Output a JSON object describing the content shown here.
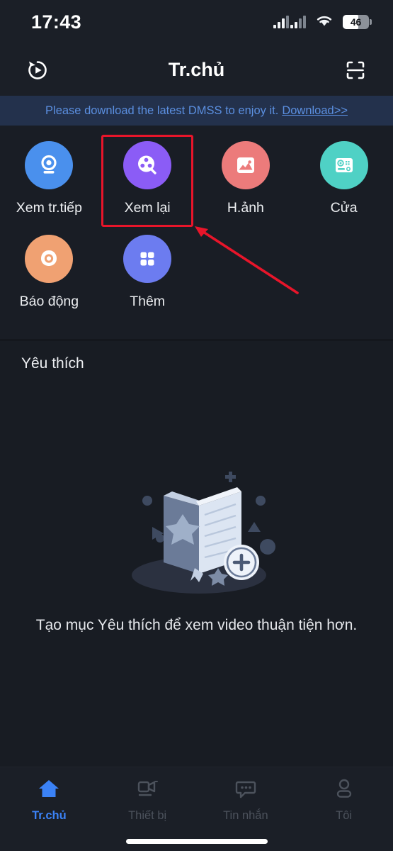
{
  "status_bar": {
    "time": "17:43",
    "signal_icon": "signal-bars-icon",
    "wifi_icon": "wifi-icon",
    "battery_level": "46"
  },
  "header": {
    "title": "Tr.chủ",
    "left_icon": "replay-history-icon",
    "right_icon": "scan-qr-icon"
  },
  "banner": {
    "message": "Please download the latest DMSS to enjoy it.",
    "link_label": "Download>>",
    "text_color": "#5b8fe0",
    "background": "#23314c"
  },
  "shortcuts": [
    {
      "label": "Xem tr.tiếp",
      "icon": "live-camera-icon",
      "color": "#4a90ed"
    },
    {
      "label": "Xem lại",
      "icon": "film-reel-icon",
      "color": "#8b5cf6"
    },
    {
      "label": "H.ảnh",
      "icon": "photo-image-icon",
      "color": "#ec7b7b"
    },
    {
      "label": "Cửa",
      "icon": "door-station-icon",
      "color": "#4fd1c5"
    },
    {
      "label": "Báo động",
      "icon": "alarm-siren-icon",
      "color": "#f0a172"
    },
    {
      "label": "Thêm",
      "icon": "more-grid-icon",
      "color": "#6c7cf0"
    }
  ],
  "favorites": {
    "section_title": "Yêu thích",
    "empty_illustration": "open-book-add-illustration",
    "empty_message": "Tạo mục Yêu thích để xem video thuận tiện hơn."
  },
  "tabbar": {
    "items": [
      {
        "label": "Tr.chủ",
        "icon": "home-icon",
        "active": true
      },
      {
        "label": "Thiết bị",
        "icon": "device-icon",
        "active": false
      },
      {
        "label": "Tin nhắn",
        "icon": "message-icon",
        "active": false
      },
      {
        "label": "Tôi",
        "icon": "profile-icon",
        "active": false
      }
    ],
    "active_color": "#3b82f6",
    "inactive_color": "#4c525c"
  },
  "annotation": {
    "highlight_target": "Xem lại",
    "box_color": "#e8152a",
    "arrow_color": "#e8152a"
  }
}
